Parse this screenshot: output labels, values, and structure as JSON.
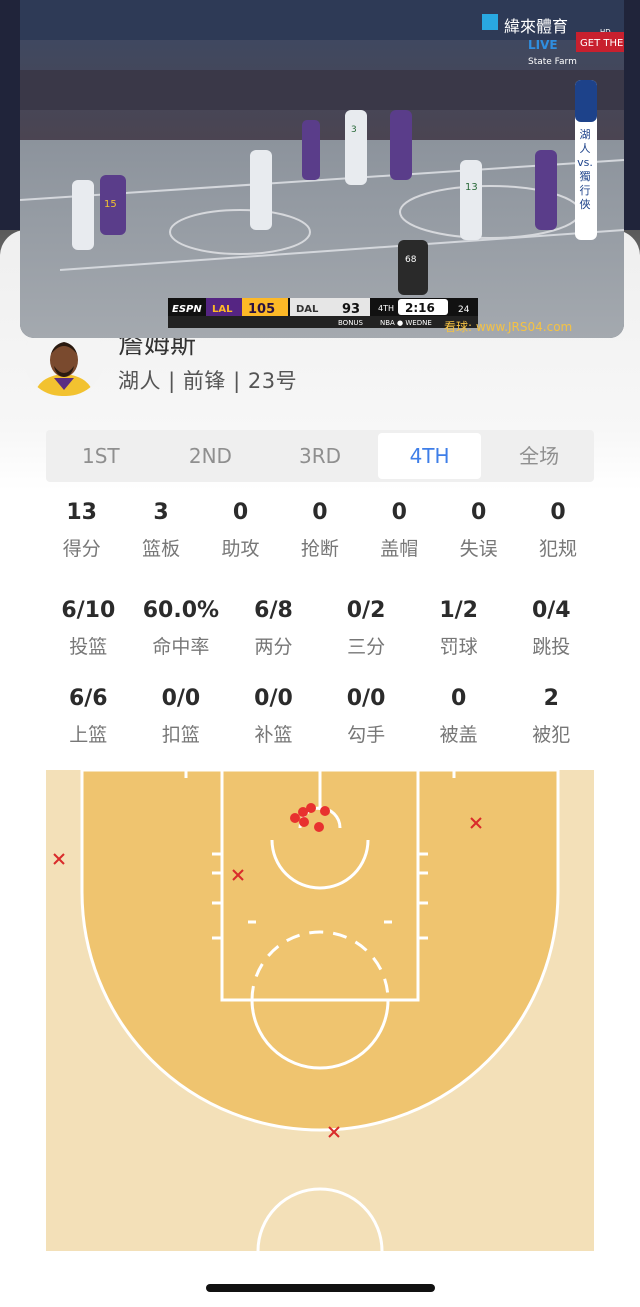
{
  "video": {
    "broadcaster": "緯來體育",
    "hd_badge": "HD",
    "live_label": "LIVE",
    "arena_banner": "GET THE B",
    "sponsor": "State Farm",
    "matchup_side_text": "湖人 vs. 獨行俠",
    "scorebug": {
      "network": "ESPN",
      "home_team": "LAL",
      "home_score": "105",
      "away_team": "DAL",
      "away_score": "93",
      "bonus": "BONUS",
      "period": "4TH",
      "clock": "2:16",
      "shot_clock": "24",
      "ticker": "NBA ● WEDNE"
    },
    "watermark": "看球: www.JRS04.com",
    "jersey_numbers": [
      "15",
      "3",
      "13",
      "68"
    ]
  },
  "player": {
    "name": "詹姆斯",
    "info": "湖人 | 前锋 | 23号"
  },
  "tabs": [
    "1ST",
    "2ND",
    "3RD",
    "4TH",
    "全场"
  ],
  "active_tab": 3,
  "stats": {
    "row1": [
      {
        "value": "13",
        "label": "得分"
      },
      {
        "value": "3",
        "label": "篮板"
      },
      {
        "value": "0",
        "label": "助攻"
      },
      {
        "value": "0",
        "label": "抢断"
      },
      {
        "value": "0",
        "label": "盖帽"
      },
      {
        "value": "0",
        "label": "失误"
      },
      {
        "value": "0",
        "label": "犯规"
      }
    ],
    "row2": [
      {
        "value": "6/10",
        "label": "投篮"
      },
      {
        "value": "60.0%",
        "label": "命中率"
      },
      {
        "value": "6/8",
        "label": "两分"
      },
      {
        "value": "0/2",
        "label": "三分"
      },
      {
        "value": "1/2",
        "label": "罚球"
      },
      {
        "value": "0/4",
        "label": "跳投"
      }
    ],
    "row3": [
      {
        "value": "6/6",
        "label": "上篮"
      },
      {
        "value": "0/0",
        "label": "扣篮"
      },
      {
        "value": "0/0",
        "label": "补篮"
      },
      {
        "value": "0/0",
        "label": "勾手"
      },
      {
        "value": "0",
        "label": "被盖"
      },
      {
        "value": "2",
        "label": "被犯"
      }
    ]
  },
  "colors": {
    "accent": "#3e7ee8",
    "made_shot": "#e8312f",
    "missed_shot": "#d92b2b",
    "court_outer": "#f3e0b8",
    "court_inner": "#efc46f"
  },
  "shot_chart": {
    "made_count": 6,
    "missed_count": 4
  }
}
